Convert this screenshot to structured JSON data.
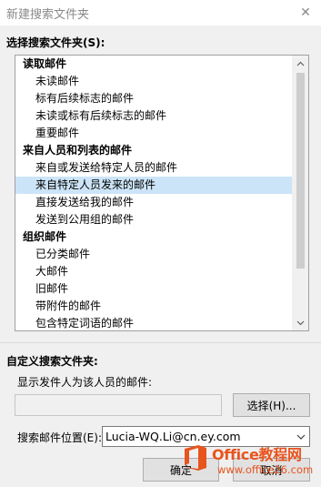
{
  "dialog": {
    "title": "新建搜索文件夹",
    "close_glyph": "✕"
  },
  "select_section": {
    "label": "选择搜索文件夹(S):",
    "groups": [
      {
        "header": "读取邮件",
        "items": [
          {
            "label": "未读邮件",
            "selected": false
          },
          {
            "label": "标有后续标志的邮件",
            "selected": false
          },
          {
            "label": "未读或标有后续标志的邮件",
            "selected": false
          },
          {
            "label": "重要邮件",
            "selected": false
          }
        ]
      },
      {
        "header": "来自人员和列表的邮件",
        "items": [
          {
            "label": "来自或发送给特定人员的邮件",
            "selected": false
          },
          {
            "label": "来自特定人员发来的邮件",
            "selected": true
          },
          {
            "label": "直接发送给我的邮件",
            "selected": false
          },
          {
            "label": "发送到公用组的邮件",
            "selected": false
          }
        ]
      },
      {
        "header": "组织邮件",
        "items": [
          {
            "label": "已分类邮件",
            "selected": false
          },
          {
            "label": "大邮件",
            "selected": false
          },
          {
            "label": "旧邮件",
            "selected": false
          },
          {
            "label": "带附件的邮件",
            "selected": false
          },
          {
            "label": "包含特定词语的邮件",
            "selected": false
          }
        ]
      }
    ]
  },
  "custom_section": {
    "label": "自定义搜索文件夹:",
    "sender_label": "显示发件人为该人员的邮件:",
    "sender_value": "",
    "choose_button": "选择(H)...",
    "location_label": "搜索邮件位置(E):",
    "location_value": "Lucia-WQ.Li@cn.ey.com"
  },
  "footer": {
    "ok_button": "确定",
    "cancel_button": "取消"
  },
  "watermark": {
    "title": "Office教程网",
    "url": "www.office26.com"
  },
  "colors": {
    "selection": "#cce4f7",
    "watermark": "#e8541e",
    "dialog_bg": "#f0f0f0"
  }
}
